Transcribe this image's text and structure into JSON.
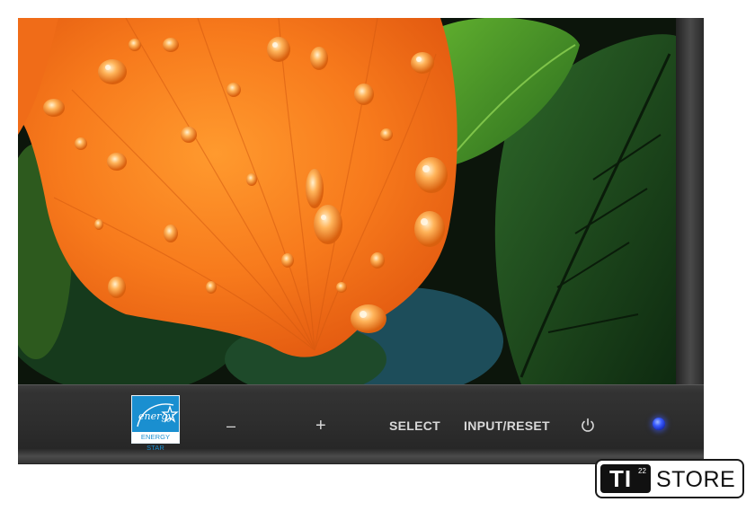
{
  "monitor": {
    "controls": {
      "minus_label": "–",
      "plus_label": "+",
      "select_label": "SELECT",
      "input_reset_label": "INPUT/RESET",
      "power_icon": "power-icon"
    },
    "energy_star": {
      "logo_text": "energy",
      "label": "ENERGY STAR"
    },
    "status_led_color": "#3a5cff",
    "screen_image": "orange hibiscus flower with water droplets on green leaves"
  },
  "store_badge": {
    "logo_text": "TI",
    "logo_sup": "22",
    "name": "STORE"
  },
  "colors": {
    "bezel": "#2c2c2c",
    "energy_star_blue": "#1a8fd0",
    "petal_orange": "#f77a1c",
    "leaf_green": "#2f7a25"
  }
}
